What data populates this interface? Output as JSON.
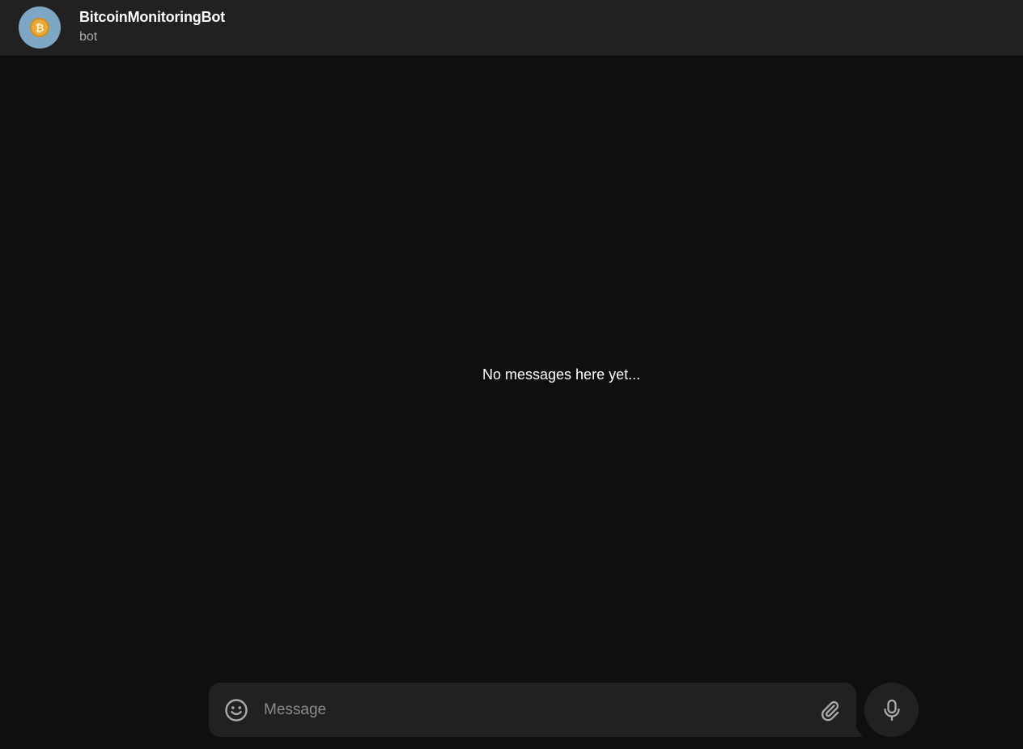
{
  "header": {
    "title": "BitcoinMonitoringBot",
    "subtitle": "bot",
    "avatar_symbol": "₿"
  },
  "messages": {
    "empty_text": "No messages here yet..."
  },
  "composer": {
    "placeholder": "Message",
    "value": ""
  },
  "icons": {
    "emoji": "smile-icon",
    "attach": "paperclip-icon",
    "mic": "microphone-icon",
    "avatar": "bitcoin-icon"
  },
  "colors": {
    "background": "#0f0f0f",
    "panel": "#212121",
    "text_primary": "#ffffff",
    "text_secondary": "#aaaaaa",
    "placeholder": "#8a8a8a",
    "icon": "#aaaaaa",
    "avatar_bg": "#7ea7c4",
    "coin": "#e9a93a"
  }
}
